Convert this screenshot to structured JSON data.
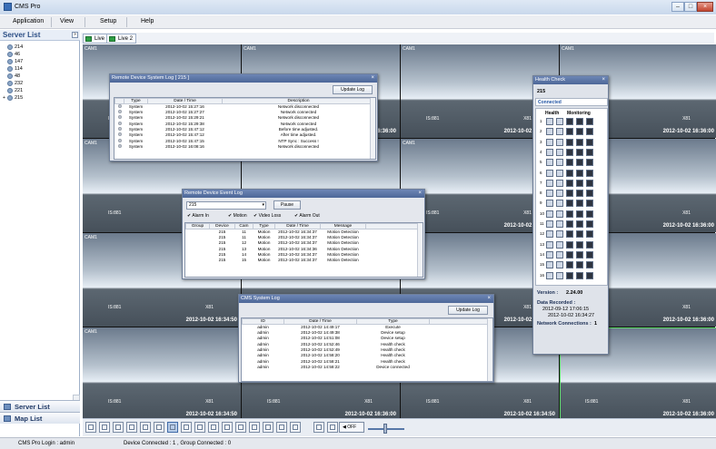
{
  "window": {
    "title": "CMS Pro"
  },
  "menu": [
    "Application",
    "View",
    "Setup",
    "Help"
  ],
  "sidebar": {
    "title": "Server List",
    "nodes": [
      "214",
      "46",
      "147",
      "114",
      "48",
      "232",
      "221",
      "215"
    ],
    "tabs": {
      "server_list": "Server List",
      "map_list": "Map List"
    }
  },
  "live_tabs": [
    "Live 1",
    "Live 2"
  ],
  "cameras": {
    "label": "CAM1",
    "timestamp_a": "2012-10-02 16:36:00",
    "timestamp_b": "2012-10-02 16:34:50",
    "mid_left": "IS:881",
    "mid_right": "X81"
  },
  "remote_system_log": {
    "title": "Remote Device System Log [ 215 ]",
    "update_button": "Update Log",
    "columns": [
      "Type",
      "Date / Time",
      "Description"
    ],
    "rows": [
      [
        "System",
        "2012-10-02 15:27:16",
        "Network disconnected"
      ],
      [
        "System",
        "2012-10-02 15:27:27",
        "Network connected"
      ],
      [
        "System",
        "2012-10-02 15:29:21",
        "Network disconnected"
      ],
      [
        "System",
        "2012-10-02 15:29:38",
        "Network connected"
      ],
      [
        "System",
        "2012-10-02 15:47:12",
        "Before time adjusted."
      ],
      [
        "System",
        "2012-10-02 15:47:12",
        "After time adjusted."
      ],
      [
        "System",
        "2012-10-02 15:47:15",
        "NTP Sync : Success !"
      ],
      [
        "System",
        "2012-10-02 16:08:16",
        "Network disconnected"
      ]
    ]
  },
  "event_log": {
    "title": "Remote Device Event Log",
    "device_select": "215",
    "pause_button": "Pause",
    "filters": [
      "Alarm In",
      "Motion",
      "Video Loss",
      "Alarm Out"
    ],
    "columns": [
      "Group",
      "Device",
      "Cam",
      "Type",
      "Date / Time",
      "Message"
    ],
    "rows": [
      [
        "",
        "215",
        "11",
        "Motion",
        "2012-10-02 16:34:37",
        "Motion Detection"
      ],
      [
        "",
        "215",
        "11",
        "Motion",
        "2012-10-02 16:34:37",
        "Motion Detection"
      ],
      [
        "",
        "215",
        "12",
        "Motion",
        "2012-10-02 16:34:37",
        "Motion Detection"
      ],
      [
        "",
        "215",
        "13",
        "Motion",
        "2012-10-02 16:34:36",
        "Motion Detection"
      ],
      [
        "",
        "215",
        "14",
        "Motion",
        "2012-10-02 16:34:37",
        "Motion Detection"
      ],
      [
        "",
        "215",
        "15",
        "Motion",
        "2012-10-02 16:34:37",
        "Motion Detection"
      ]
    ]
  },
  "cms_log": {
    "title": "CMS System Log",
    "update_button": "Update Log",
    "columns": [
      "ID",
      "Date / Time",
      "Type"
    ],
    "rows": [
      [
        "admin",
        "2012-10-02 14:49:17",
        "Execute"
      ],
      [
        "admin",
        "2012-10-02 14:49:38",
        "Device setup"
      ],
      [
        "admin",
        "2012-10-02 14:51:08",
        "Device setup"
      ],
      [
        "admin",
        "2012-10-02 14:52:46",
        "Health check"
      ],
      [
        "admin",
        "2012-10-02 14:52:49",
        "Health check"
      ],
      [
        "admin",
        "2012-10-02 14:58:20",
        "Health check"
      ],
      [
        "admin",
        "2012-10-02 14:58:21",
        "Health check"
      ],
      [
        "admin",
        "2012-10-02 14:58:22",
        "Device connected"
      ]
    ]
  },
  "health_check": {
    "title": "Health Check",
    "device": "215",
    "status": "Connected",
    "tab_health": "Health",
    "tab_monitoring": "Monitoring",
    "channels": [
      "1",
      "2",
      "3",
      "4",
      "5",
      "6",
      "7",
      "8",
      "9",
      "10",
      "11",
      "12",
      "13",
      "14",
      "15",
      "16"
    ],
    "version_label": "Version :",
    "version": "2.24.00",
    "data_recorded_label": "Data Recorded :",
    "recorded_from": "2012-09-12 17:06:15",
    "recorded_to": "2012-10-02 16:34:27",
    "network_label": "Network Connections :",
    "network_count": "1"
  },
  "status": {
    "login": "CMS Pro Login : admin",
    "connections": "Device Connected : 1 , Group Connected : 0"
  }
}
